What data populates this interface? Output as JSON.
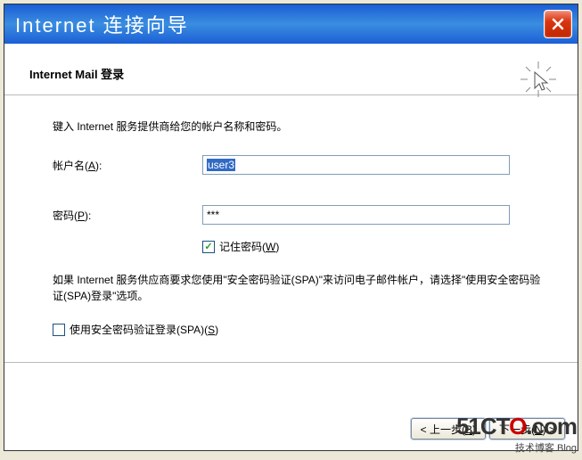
{
  "titlebar": {
    "title": "Internet 连接向导"
  },
  "header": {
    "title": "Internet Mail 登录"
  },
  "body": {
    "intro": "键入 Internet 服务提供商给您的帐户名称和密码。",
    "account_label": "帐户名(A):",
    "account_value": "user3",
    "password_label": "密码(P):",
    "password_value": "***",
    "remember_label": "记住密码(W)",
    "remember_checked": true,
    "info_text": "如果 Internet 服务供应商要求您使用\"安全密码验证(SPA)\"来访问电子邮件帐户，请选择\"使用安全密码验证(SPA)登录\"选项。",
    "spa_label": "使用安全密码验证登录(SPA)(S)",
    "spa_checked": false
  },
  "buttons": {
    "back": "< 上一步(B)",
    "next": "下一步(N) >"
  },
  "watermark": {
    "brand_pre": "51CT",
    "brand_o": "O",
    "brand_post": ".com",
    "sub": "技术博客   Blog"
  }
}
